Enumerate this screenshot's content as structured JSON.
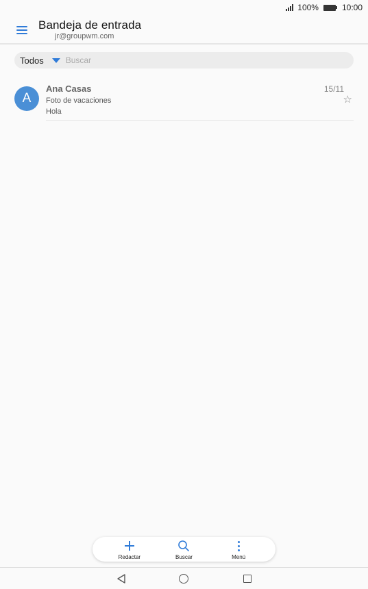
{
  "status_bar": {
    "battery": "100%",
    "time": "10:00"
  },
  "header": {
    "title": "Bandeja de entrada",
    "account": "jr@groupwm.com"
  },
  "filter": {
    "selected": "Todos",
    "search_placeholder": "Buscar"
  },
  "messages": [
    {
      "initial": "A",
      "sender": "Ana Casas",
      "subject": "Foto de vacaciones",
      "preview": "Hola",
      "date": "15/11",
      "starred": false
    }
  ],
  "toolbar": {
    "compose_label": "Redactar",
    "search_label": "Buscar",
    "menu_label": "Menú"
  },
  "icons": {
    "menu": "hamburger-icon",
    "dropdown": "caret-down-icon",
    "star": "star-outline-icon",
    "compose": "plus-icon",
    "search": "search-icon",
    "more": "more-vertical-icon"
  },
  "colors": {
    "accent": "#2f7bd8",
    "avatar": "#4a8fd6",
    "background": "#fafafa"
  }
}
